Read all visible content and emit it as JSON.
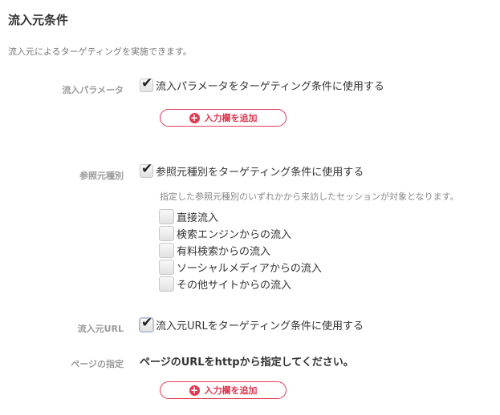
{
  "section": {
    "title": "流入元条件",
    "description": "流入元によるターゲティングを実施できます。"
  },
  "param": {
    "label": "流入パラメータ",
    "checkbox_label": "流入パラメータをターゲティング条件に使用する",
    "checked": true,
    "add_button": "入力欄を追加"
  },
  "referrer_type": {
    "label": "参照元種別",
    "checkbox_label": "参照元種別をターゲティング条件に使用する",
    "checked": true,
    "note": "指定した参照元種別のいずれかから来訪したセッションが対象となります。",
    "options": [
      {
        "label": "直接流入",
        "checked": false
      },
      {
        "label": "検索エンジンからの流入",
        "checked": false
      },
      {
        "label": "有料検索からの流入",
        "checked": false
      },
      {
        "label": "ソーシャルメディアからの流入",
        "checked": false
      },
      {
        "label": "その他サイトからの流入",
        "checked": false
      }
    ]
  },
  "referrer_url": {
    "label": "流入元URL",
    "checkbox_label": "流入元URLをターゲティング条件に使用する",
    "checked": true
  },
  "page_spec": {
    "label": "ページの指定",
    "instruction": "ページのURLをhttpから指定してください。",
    "add_button": "入力欄を追加"
  },
  "icons": {
    "plus": "plus-circle-icon",
    "check": "checkmark-icon"
  },
  "colors": {
    "accent": "#e03a52",
    "label_gray": "#9a9a9a"
  }
}
